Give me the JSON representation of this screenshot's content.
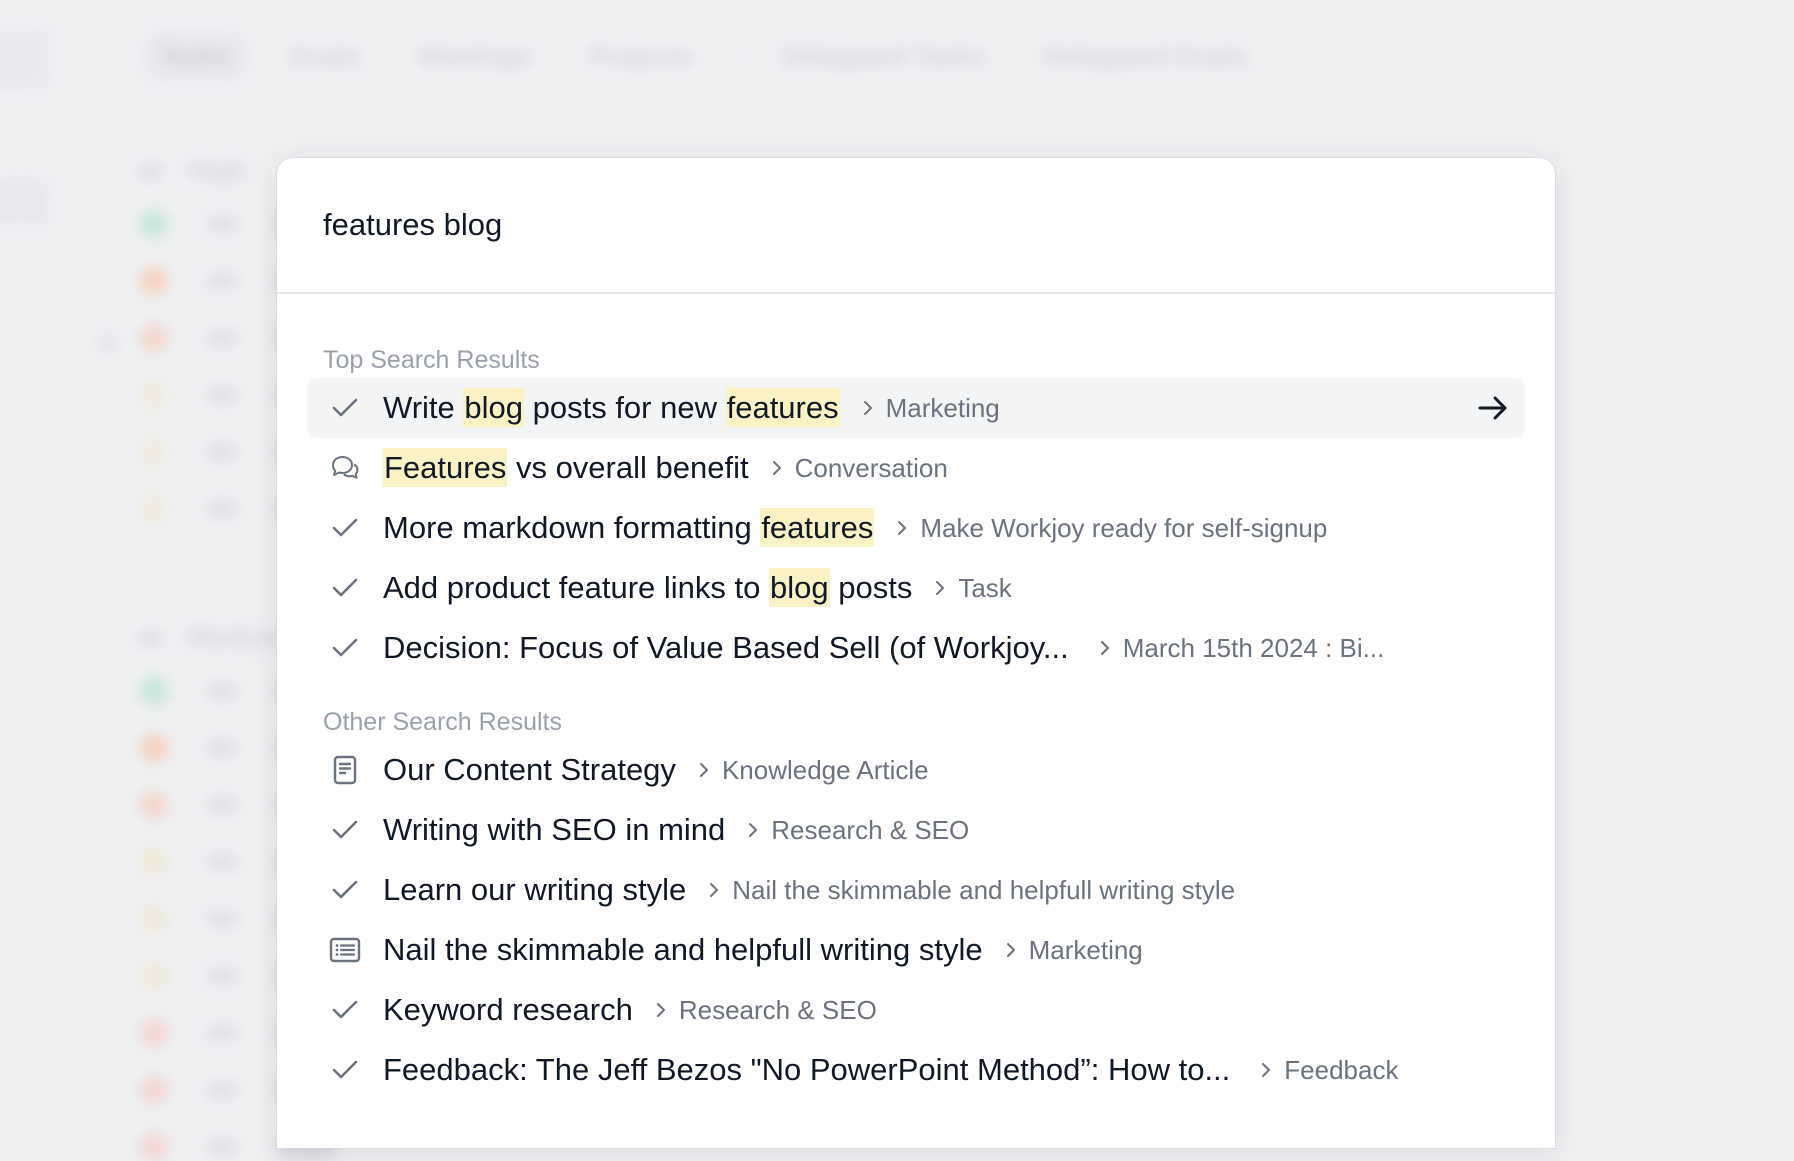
{
  "background": {
    "tabs": [
      {
        "label": "Tasks",
        "active": true
      },
      {
        "label": "Goals",
        "active": false
      },
      {
        "label": "Meetings",
        "active": false
      },
      {
        "label": "Projects",
        "active": false
      },
      {
        "label": "Delegated Tasks",
        "active": false
      },
      {
        "label": "Delegated Goals",
        "active": false
      }
    ],
    "groups": [
      {
        "label": "High",
        "dot_colors": [
          "#bfe3d6",
          "#f4cdb3",
          "#f3d2c4",
          "#f3ead6",
          "#f3ead6",
          "#f3ead6"
        ]
      },
      {
        "label": "Medium",
        "dot_colors": [
          "#bfe3d6",
          "#f4cdb3",
          "#f3d2c4",
          "#f1e8d2",
          "#f1e8d2",
          "#f1e8d2",
          "#f3d2c8",
          "#f3d2c8",
          "#f3d2c8"
        ]
      }
    ]
  },
  "search": {
    "query": "features blog",
    "placeholder": ""
  },
  "colors": {
    "highlight": "#fbf2c4",
    "selected_row": "#f3f4f6",
    "title_text": "#111827",
    "crumb_text": "#6b7280",
    "section_label": "#9aa1ad"
  },
  "sections": [
    {
      "label": "Top Search Results",
      "results": [
        {
          "icon": "check-icon",
          "title_parts": [
            {
              "t": "Write "
            },
            {
              "t": "blog",
              "hl": true
            },
            {
              "t": " posts for new "
            },
            {
              "t": "features",
              "hl": true
            }
          ],
          "crumb": "Marketing",
          "selected": true
        },
        {
          "icon": "conversation-icon",
          "title_parts": [
            {
              "t": "Features",
              "hl": true
            },
            {
              "t": " vs overall benefit"
            }
          ],
          "crumb": "Conversation"
        },
        {
          "icon": "check-icon",
          "title_parts": [
            {
              "t": "More markdown formatting "
            },
            {
              "t": "features",
              "hl": true
            }
          ],
          "crumb": "Make Workjoy ready for self-signup"
        },
        {
          "icon": "check-icon",
          "title_parts": [
            {
              "t": "Add product feature links to "
            },
            {
              "t": "blog",
              "hl": true
            },
            {
              "t": " posts"
            }
          ],
          "crumb": "Task"
        },
        {
          "icon": "check-icon",
          "title_parts": [
            {
              "t": "Decision: Focus of Value Based Sell (of Workjoy..."
            }
          ],
          "crumb": "March 15th 2024 : Bi...",
          "wide_gap": true
        }
      ]
    },
    {
      "label": "Other Search Results",
      "results": [
        {
          "icon": "document-icon",
          "title_parts": [
            {
              "t": "Our Content Strategy"
            }
          ],
          "crumb": "Knowledge Article"
        },
        {
          "icon": "check-icon",
          "title_parts": [
            {
              "t": "Writing with SEO in mind"
            }
          ],
          "crumb": "Research & SEO"
        },
        {
          "icon": "check-icon",
          "title_parts": [
            {
              "t": "Learn our writing style"
            }
          ],
          "crumb": "Nail the skimmable and helpfull writing style"
        },
        {
          "icon": "list-icon",
          "title_parts": [
            {
              "t": "Nail the skimmable and helpfull writing style"
            }
          ],
          "crumb": "Marketing"
        },
        {
          "icon": "check-icon",
          "title_parts": [
            {
              "t": "Keyword research"
            }
          ],
          "crumb": "Research & SEO"
        },
        {
          "icon": "check-icon",
          "title_parts": [
            {
              "t": "Feedback: The Jeff Bezos \"No PowerPoint Method”: How to..."
            }
          ],
          "crumb": "Feedback",
          "wide_gap": true
        }
      ]
    }
  ]
}
